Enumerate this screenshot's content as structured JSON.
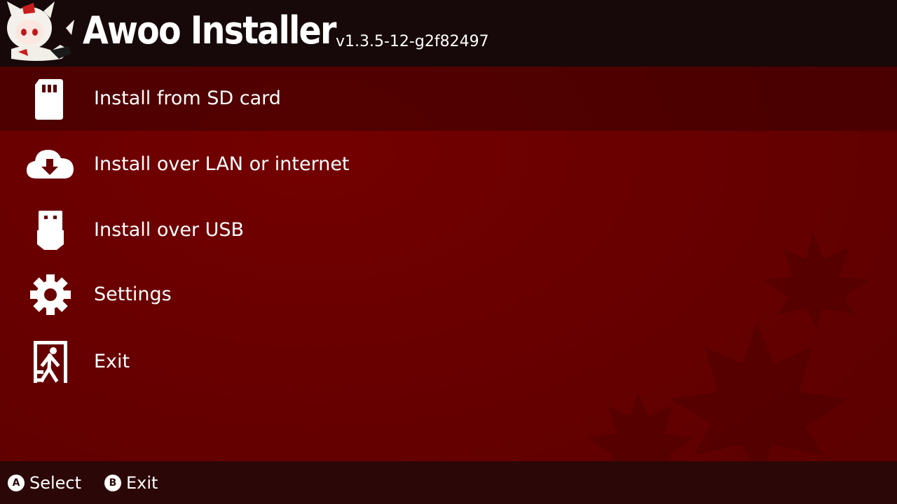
{
  "header": {
    "title": "Awoo Installer",
    "version": "v1.3.5-12-g2f82497",
    "mascot": "wolf-girl-mascot"
  },
  "menu": {
    "selected_index": 0,
    "items": [
      {
        "label": "Install from SD card",
        "icon": "sd-card-icon"
      },
      {
        "label": "Install over LAN or internet",
        "icon": "cloud-download-icon"
      },
      {
        "label": "Install over USB",
        "icon": "usb-icon"
      },
      {
        "label": "Settings",
        "icon": "gear-icon"
      },
      {
        "label": "Exit",
        "icon": "exit-icon"
      }
    ]
  },
  "footer": {
    "hints": [
      {
        "button": "A",
        "label": "Select"
      },
      {
        "button": "B",
        "label": "Exit"
      }
    ]
  },
  "colors": {
    "background": "#6b0000",
    "header": "#170909",
    "footer": "#2c0707",
    "selected_row": "#4f0000",
    "text": "#ffffff"
  }
}
